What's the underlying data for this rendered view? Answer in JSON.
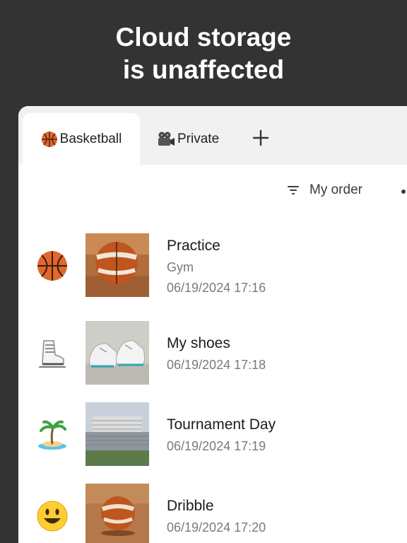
{
  "headline": {
    "line1": "Cloud storage",
    "line2": "is unaffected"
  },
  "tabs": [
    {
      "label": "Basketball",
      "icon": "basketball-icon",
      "active": true
    },
    {
      "label": "Private",
      "icon": "movie-camera-icon",
      "active": false
    }
  ],
  "sort": {
    "label": "My order"
  },
  "items": [
    {
      "icon": "basketball-icon",
      "title": "Practice",
      "subtitle": "Gym",
      "date": "06/19/2024 17:16"
    },
    {
      "icon": "ice-skate-icon",
      "title": "My shoes",
      "date": "06/19/2024 17:18"
    },
    {
      "icon": "desert-island-icon",
      "title": "Tournament Day",
      "date": "06/19/2024 17:19"
    },
    {
      "icon": "smiley-icon",
      "title": "Dribble",
      "date": "06/19/2024 17:20"
    }
  ],
  "colors": {
    "background": "#333333",
    "accent_orange": "#d9622b"
  }
}
